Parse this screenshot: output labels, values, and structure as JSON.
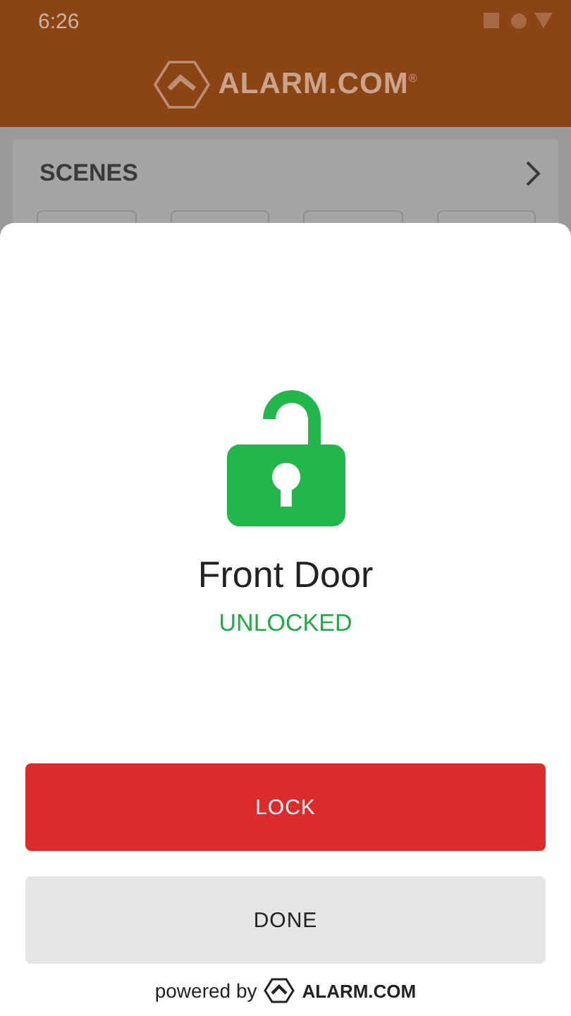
{
  "status_bar": {
    "time": "6:26"
  },
  "header": {
    "logo_text": "ALARM.COM",
    "logo_mark": "®"
  },
  "scenes": {
    "title": "SCENES",
    "tiles": [
      {
        "kind": "tile"
      },
      {
        "kind": "tile"
      },
      {
        "kind": "tile"
      },
      {
        "kind": "tile"
      }
    ]
  },
  "sheet": {
    "device": "Front Door",
    "locked": false,
    "status": "UNLOCKED",
    "buttons": [
      {
        "label": "LOCK",
        "kind": "primary"
      },
      {
        "label": "DONE",
        "kind": "secondary"
      }
    ],
    "footer": {
      "prefix": "powered by",
      "logo_text": "ALARM.COM"
    }
  }
}
